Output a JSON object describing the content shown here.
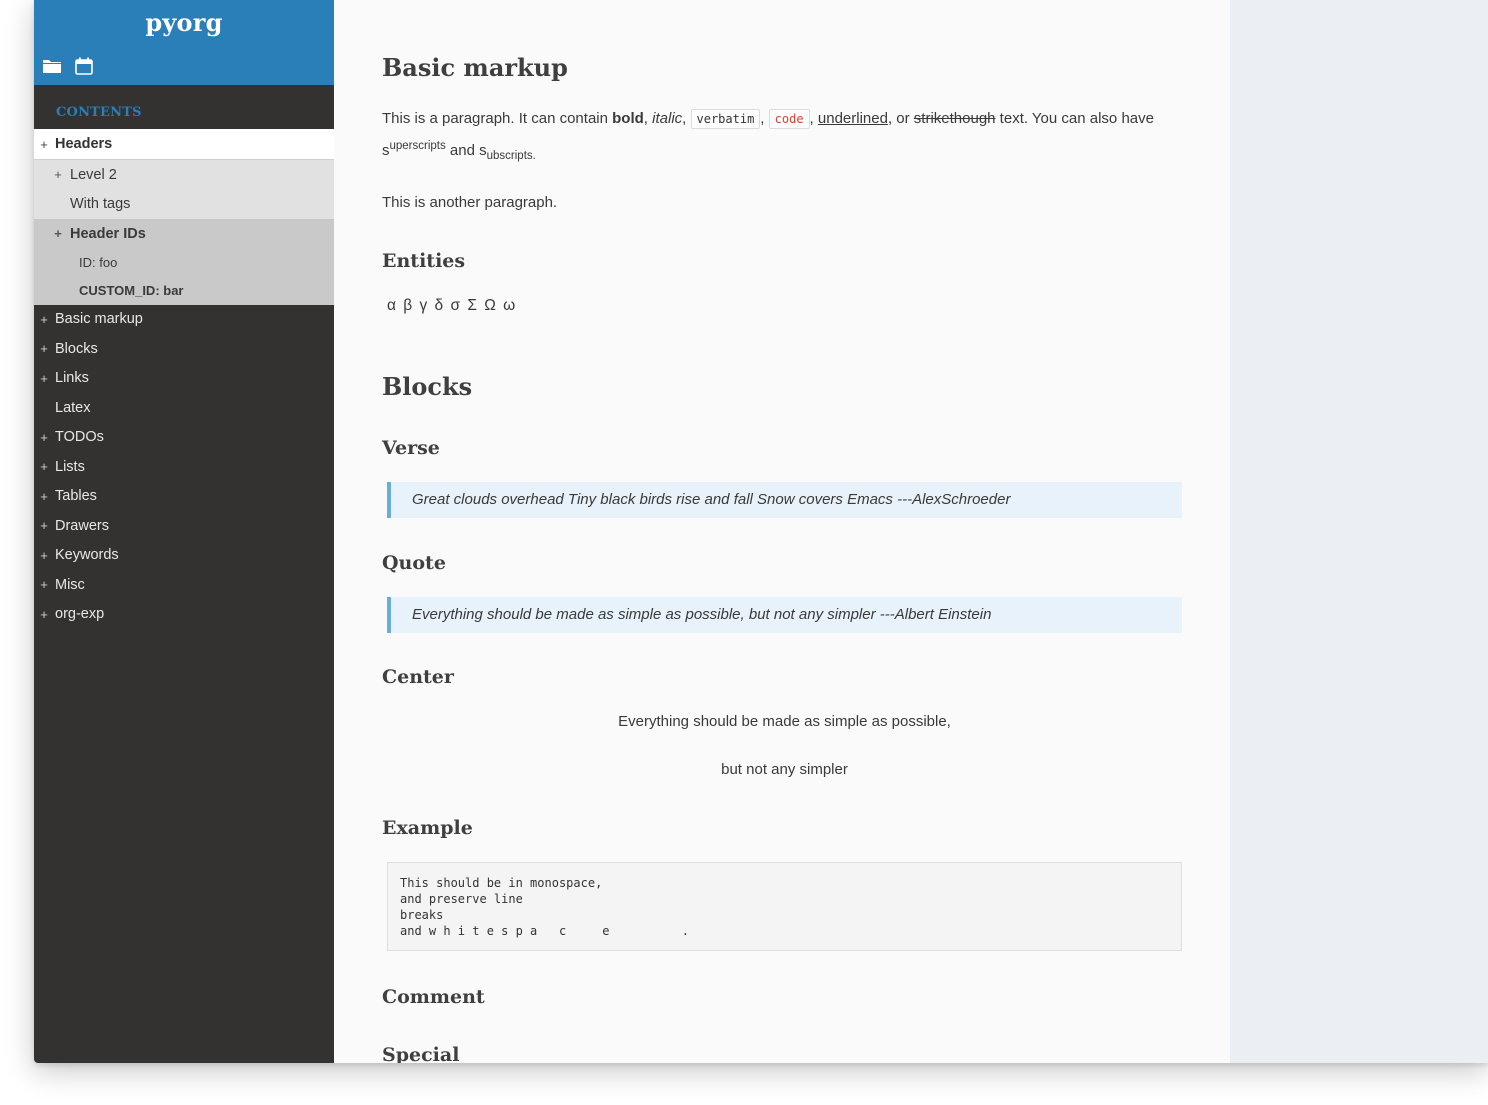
{
  "app": {
    "title": "pyorg"
  },
  "header_icons": [
    {
      "name": "folder-icon",
      "label": "Files"
    },
    {
      "name": "calendar-icon",
      "label": "Agenda"
    }
  ],
  "sidebar": {
    "contents_label": "CONTENTS",
    "items": [
      {
        "label": "Headers",
        "expandable": true,
        "level": 1,
        "active": true
      },
      {
        "label": "Level 2",
        "expandable": true,
        "level": 2
      },
      {
        "label": "With tags",
        "expandable": false,
        "level": 2
      },
      {
        "label": "Header IDs",
        "expandable": true,
        "level": 2,
        "selected": true
      },
      {
        "label": "ID: foo",
        "expandable": false,
        "level": 3
      },
      {
        "label": "CUSTOM_ID: bar",
        "expandable": false,
        "level": 3
      },
      {
        "label": "Basic markup",
        "expandable": true,
        "level": 1
      },
      {
        "label": "Blocks",
        "expandable": true,
        "level": 1
      },
      {
        "label": "Links",
        "expandable": true,
        "level": 1
      },
      {
        "label": "Latex",
        "expandable": false,
        "level": 1
      },
      {
        "label": "TODOs",
        "expandable": true,
        "level": 1
      },
      {
        "label": "Lists",
        "expandable": true,
        "level": 1
      },
      {
        "label": "Tables",
        "expandable": true,
        "level": 1
      },
      {
        "label": "Drawers",
        "expandable": true,
        "level": 1
      },
      {
        "label": "Keywords",
        "expandable": true,
        "level": 1
      },
      {
        "label": "Misc",
        "expandable": true,
        "level": 1
      },
      {
        "label": "org-exp",
        "expandable": true,
        "level": 1
      }
    ],
    "expand_glyph": "+"
  },
  "document": {
    "basic_markup": {
      "heading": "Basic markup",
      "para1": {
        "t1": "This is a paragraph. It can contain ",
        "bold": "bold",
        "t2": ", ",
        "italic": "italic",
        "t3": ", ",
        "verbatim": "verbatim",
        "t4": ", ",
        "code": "code",
        "t5": ", ",
        "underlined": "underlined",
        "t6": ", or ",
        "strike": "strikethough",
        "t7": " text. You can also have",
        "s1": "s",
        "sup": "uperscripts",
        "t8": " and ",
        "s2": "s",
        "sub": "ubscripts",
        "t9": "."
      },
      "para2": "This is another paragraph."
    },
    "entities": {
      "heading": "Entities",
      "text": "α β γ δ σ Σ Ω ω"
    },
    "blocks": {
      "heading": "Blocks",
      "verse": {
        "heading": "Verse",
        "text": "Great clouds overhead Tiny black birds rise and fall Snow covers Emacs ---AlexSchroeder"
      },
      "quote": {
        "heading": "Quote",
        "text": "Everything should be made as simple as possible, but not any simpler ---Albert Einstein"
      },
      "center": {
        "heading": "Center",
        "line1": "Everything should be made as simple as possible,",
        "line2": "but not any simpler"
      },
      "example": {
        "heading": "Example",
        "text": "This should be in monospace,\nand preserve line\nbreaks\nand w h i t e s p a   c     e          ."
      },
      "comment": {
        "heading": "Comment"
      },
      "special": {
        "heading": "Special"
      }
    }
  }
}
